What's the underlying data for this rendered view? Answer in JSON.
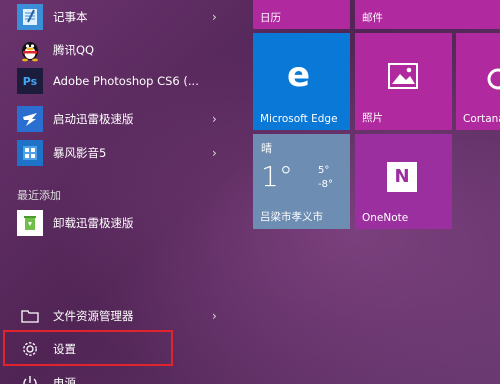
{
  "apps": [
    {
      "label": "记事本",
      "icon": "notepad-icon",
      "arrow": "›"
    },
    {
      "label": "腾讯QQ",
      "icon": "qq-penguin-icon",
      "arrow": ""
    },
    {
      "label": "Adobe Photoshop CS6 (...",
      "icon": "photoshop-icon",
      "icon_text": "Ps",
      "arrow": ""
    },
    {
      "label": "启动迅雷极速版",
      "icon": "thunder-icon",
      "arrow": "›"
    },
    {
      "label": "暴风影音5",
      "icon": "baofeng-icon",
      "arrow": "›"
    }
  ],
  "recent_header": "最近添加",
  "recent": [
    {
      "label": "卸载迅雷极速版",
      "icon": "recycle-bin-icon"
    }
  ],
  "bottom": [
    {
      "label": "文件资源管理器",
      "icon": "folder-icon",
      "arrow": "›"
    },
    {
      "label": "设置",
      "icon": "gear-icon"
    },
    {
      "label": "电源",
      "icon": "power-icon"
    }
  ],
  "tiles": {
    "calendar": {
      "label": "日历",
      "color": "#b0299e"
    },
    "mail": {
      "label": "邮件",
      "color": "#b0299e"
    },
    "edge": {
      "label": "Microsoft Edge",
      "color": "#0a78d7",
      "glyph": "e"
    },
    "photos": {
      "label": "照片",
      "color": "#b0299e"
    },
    "cortana": {
      "label": "Cortana",
      "color": "#b0299e"
    },
    "weather": {
      "condition": "晴",
      "temp": "1°",
      "high": "5°",
      "low": "-8°",
      "location": "吕梁市孝义市"
    },
    "onenote": {
      "label": "OneNote",
      "color": "#9b2fa0",
      "glyph": "N"
    }
  }
}
